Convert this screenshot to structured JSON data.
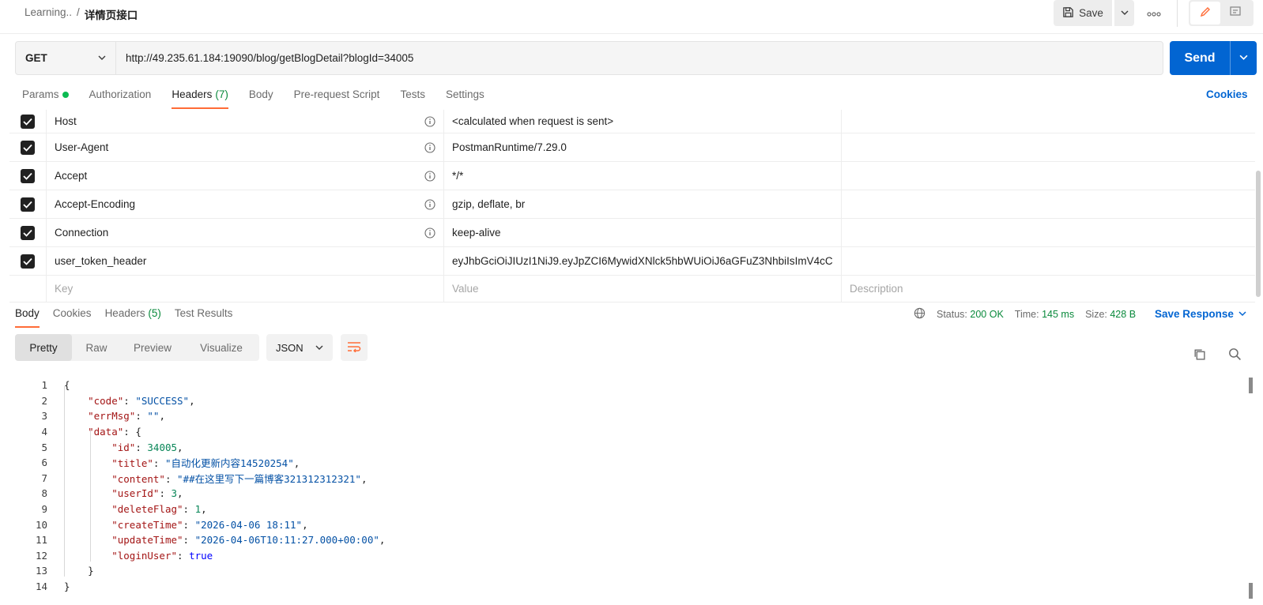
{
  "breadcrumb": {
    "parent": "Learning..",
    "separator": "/",
    "current": "详情页接口"
  },
  "toolbar": {
    "save_label": "Save"
  },
  "request": {
    "method": "GET",
    "url": "http://49.235.61.184:19090/blog/getBlogDetail?blogId=34005",
    "send_label": "Send"
  },
  "req_tabs": {
    "params": "Params",
    "authorization": "Authorization",
    "headers": "Headers",
    "headers_count": "(7)",
    "body": "Body",
    "prerequest": "Pre-request Script",
    "tests": "Tests",
    "settings": "Settings",
    "cookies": "Cookies"
  },
  "headers": {
    "rows": [
      {
        "key": "Host",
        "value": "<calculated when request is sent>"
      },
      {
        "key": "User-Agent",
        "value": "PostmanRuntime/7.29.0"
      },
      {
        "key": "Accept",
        "value": "*/*"
      },
      {
        "key": "Accept-Encoding",
        "value": "gzip, deflate, br"
      },
      {
        "key": "Connection",
        "value": "keep-alive"
      },
      {
        "key": "user_token_header",
        "value": "eyJhbGciOiJIUzI1NiJ9.eyJpZCI6MywidXNlck5hbWUiOiJ6aGFuZ3NhbiIsImV4cC"
      }
    ],
    "placeholder_key": "Key",
    "placeholder_value": "Value",
    "placeholder_description": "Description"
  },
  "response": {
    "tabs": {
      "body": "Body",
      "cookies": "Cookies",
      "headers": "Headers",
      "headers_count": "(5)",
      "test_results": "Test Results"
    },
    "status_label": "Status:",
    "status_value": "200 OK",
    "time_label": "Time:",
    "time_value": "145 ms",
    "size_label": "Size:",
    "size_value": "428 B",
    "save_response": "Save Response",
    "views": {
      "pretty": "Pretty",
      "raw": "Raw",
      "preview": "Preview",
      "visualize": "Visualize"
    },
    "format": "JSON"
  },
  "code": {
    "line_numbers": [
      "1",
      "2",
      "3",
      "4",
      "5",
      "6",
      "7",
      "8",
      "9",
      "10",
      "11",
      "12",
      "13",
      "14"
    ],
    "l1": "{",
    "code_key": "\"code\"",
    "code_val": "\"SUCCESS\"",
    "err_key": "\"errMsg\"",
    "err_val": "\"\"",
    "data_key": "\"data\"",
    "id_key": "\"id\"",
    "id_val": "34005",
    "title_key": "\"title\"",
    "title_val": "\"自动化更新内容14520254\"",
    "content_key": "\"content\"",
    "content_val": "\"##在这里写下一篇博客321312312321\"",
    "userid_key": "\"userId\"",
    "userid_val": "3",
    "deleteflag_key": "\"deleteFlag\"",
    "deleteflag_val": "1",
    "createtime_key": "\"createTime\"",
    "createtime_val": "\"2026-04-06 18:11\"",
    "updatetime_key": "\"updateTime\"",
    "updatetime_val": "\"2026-04-06T10:11:27.000+00:00\"",
    "loginuser_key": "\"loginUser\"",
    "loginuser_val": "true",
    "l13": "}",
    "l14": "}"
  },
  "colors": {
    "accent": "#ff6c37",
    "primary": "#0265d2",
    "success": "#0a8a3c"
  }
}
